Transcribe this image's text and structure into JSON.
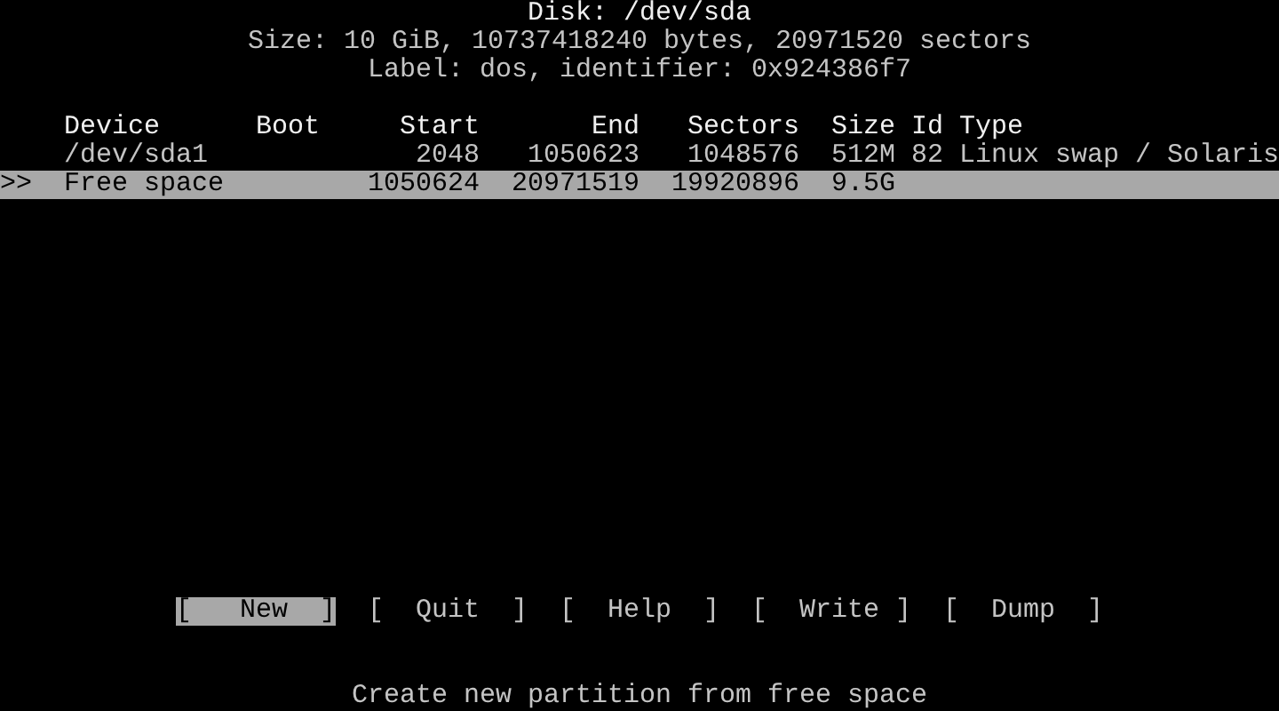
{
  "disk": {
    "title": "Disk: /dev/sda",
    "size_line": "Size: 10 GiB, 10737418240 bytes, 20971520 sectors",
    "label_line": "Label: dos, identifier: 0x924386f7"
  },
  "table": {
    "columns": [
      "Device",
      "Boot",
      "Start",
      "End",
      "Sectors",
      "Size",
      "Id",
      "Type"
    ],
    "rows": [
      {
        "marker": "",
        "selected": false,
        "cells": [
          "/dev/sda1",
          "",
          "2048",
          "1050623",
          "1048576",
          "512M",
          "82",
          "Linux swap / Solaris"
        ]
      },
      {
        "marker": ">>",
        "selected": true,
        "cells": [
          "Free space",
          "",
          "1050624",
          "20971519",
          "19920896",
          "9.5G",
          "",
          ""
        ]
      }
    ]
  },
  "buttons": [
    {
      "label": "[   New  ]",
      "selected": true
    },
    {
      "label": "[  Quit  ]",
      "selected": false
    },
    {
      "label": "[  Help  ]",
      "selected": false
    },
    {
      "label": "[  Write ]",
      "selected": false
    },
    {
      "label": "[  Dump  ]",
      "selected": false
    }
  ],
  "status_bar": "Create new partition from free space"
}
